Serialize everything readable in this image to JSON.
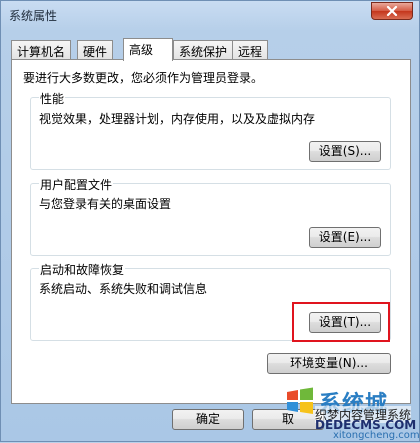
{
  "window": {
    "title": "系统属性"
  },
  "tabs": [
    {
      "label": "计算机名"
    },
    {
      "label": "硬件"
    },
    {
      "label": "高级"
    },
    {
      "label": "系统保护"
    },
    {
      "label": "远程"
    }
  ],
  "notice": "要进行大多数更改，您必须作为管理员登录。",
  "groups": {
    "performance": {
      "title": "性能",
      "description": "视觉效果，处理器计划，内存使用，以及及虚拟内存",
      "button": "设置(S)..."
    },
    "user_profiles": {
      "title": "用户配置文件",
      "description": "与您登录有关的桌面设置",
      "button": "设置(E)..."
    },
    "startup_recovery": {
      "title": "启动和故障恢复",
      "description": "系统启动、系统失败和调试信息",
      "button": "设置(T)..."
    }
  },
  "env_button": "环境变量(N)...",
  "footer": {
    "ok": "确定",
    "cancel": "取"
  },
  "watermark": {
    "logo": "系统城",
    "subtitle": "织梦内容管理系统",
    "url": "DEDECMS.COM",
    "url2": "xitongcheng.com"
  },
  "colors": {
    "highlight": "#e0141e",
    "close_button": "#c4361c"
  }
}
